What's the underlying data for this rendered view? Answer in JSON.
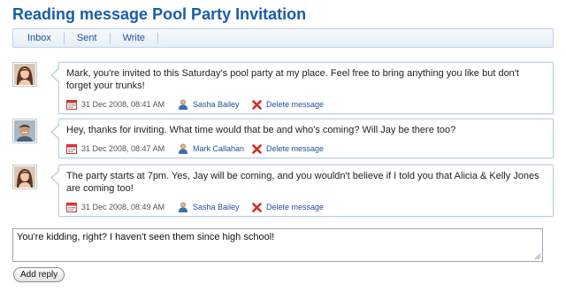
{
  "page": {
    "title": "Reading message Pool Party Invitation"
  },
  "nav": {
    "items": [
      "Inbox",
      "Sent",
      "Write"
    ]
  },
  "messages": [
    {
      "avatar": "female-avatar-icon",
      "text": "Mark, you're invited to this Saturday's pool party at my place. Feel free to bring anything you like but don't forget your trunks!",
      "date": "31 Dec 2008, 08:41 AM",
      "author": "Sasha Bailey",
      "delete_label": "Delete message"
    },
    {
      "avatar": "male-avatar-icon",
      "text": "Hey, thanks for inviting. What time would that be and who's coming? Will Jay be there too?",
      "date": "31 Dec 2008, 08:47 AM",
      "author": "Mark Callahan",
      "delete_label": "Delete message"
    },
    {
      "avatar": "female-avatar-icon",
      "text": "The party starts at 7pm. Yes, Jay will be coming, and you wouldn't believe if I told you that Alicia & Kelly Jones are coming too!",
      "date": "31 Dec 2008, 08:49 AM",
      "author": "Sasha Bailey",
      "delete_label": "Delete message"
    }
  ],
  "reply": {
    "value": "You're kidding, right? I haven't seen them since high school!",
    "button_label": "Add reply"
  },
  "colors": {
    "title": "#1a5da8",
    "link": "#1f4f9a",
    "bubble_border": "#b8cfe3",
    "delete": "#d6281e"
  }
}
